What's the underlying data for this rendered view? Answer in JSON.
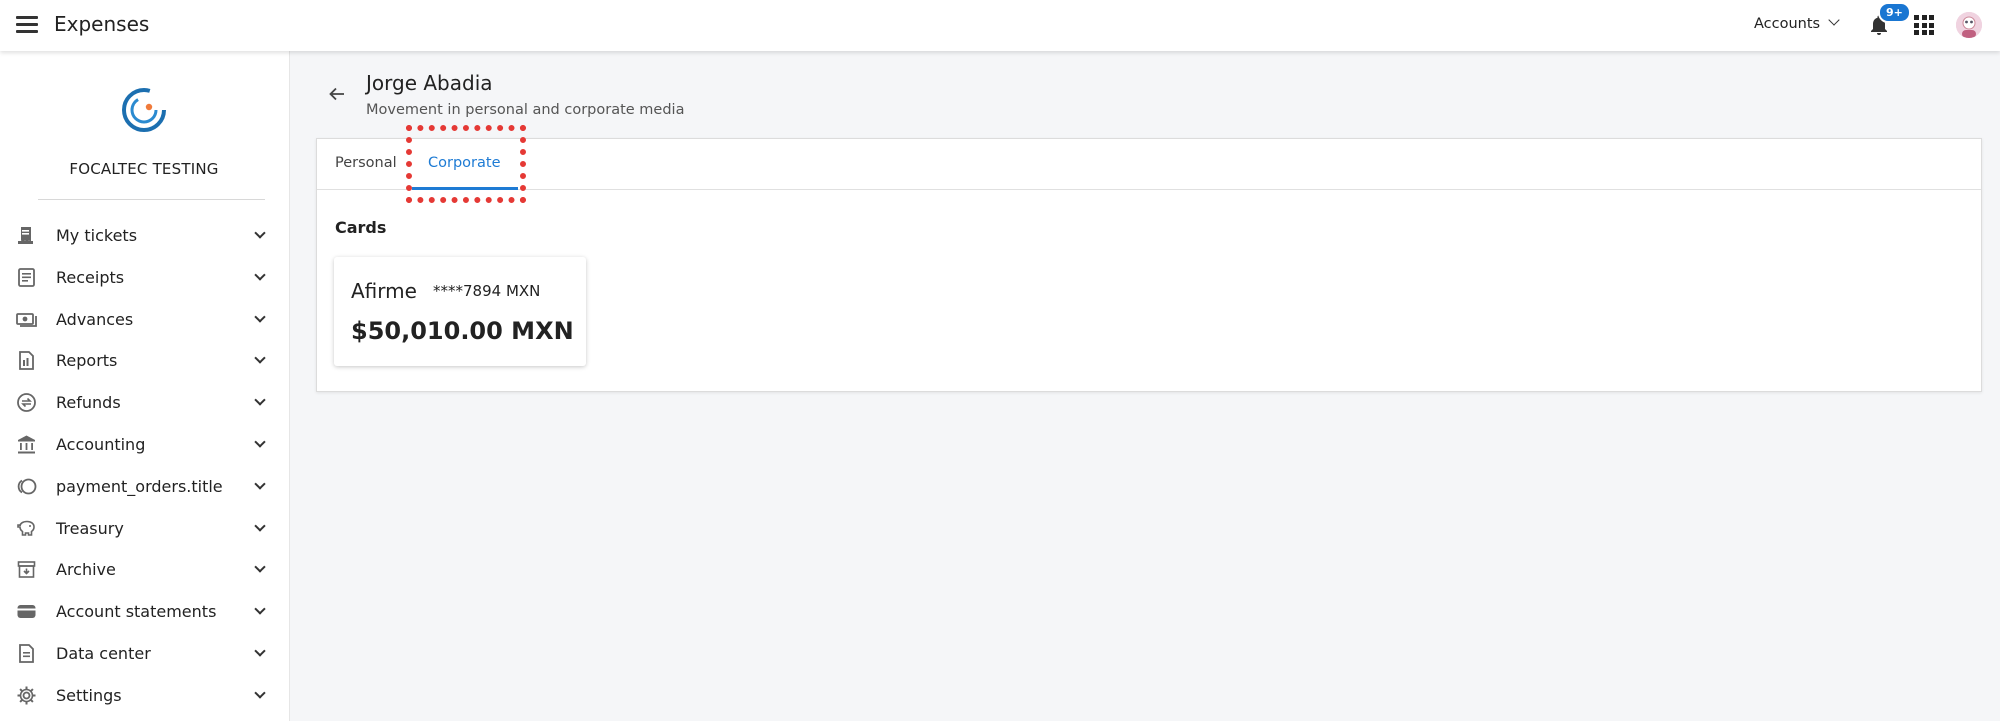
{
  "header": {
    "app_title": "Expenses",
    "accounts_label": "Accounts",
    "notifications_badge": "9+"
  },
  "sidebar": {
    "org_name": "FOCALTEC TESTING",
    "items": [
      {
        "label": "My tickets",
        "icon": "ticket-icon"
      },
      {
        "label": "Receipts",
        "icon": "receipt-icon"
      },
      {
        "label": "Advances",
        "icon": "cash-icon"
      },
      {
        "label": "Reports",
        "icon": "report-icon"
      },
      {
        "label": "Refunds",
        "icon": "refund-icon"
      },
      {
        "label": "Accounting",
        "icon": "bank-icon"
      },
      {
        "label": "payment_orders.title",
        "icon": "coins-icon"
      },
      {
        "label": "Treasury",
        "icon": "piggy-bank-icon"
      },
      {
        "label": "Archive",
        "icon": "archive-icon"
      },
      {
        "label": "Account statements",
        "icon": "wallet-icon"
      },
      {
        "label": "Data center",
        "icon": "data-file-icon"
      },
      {
        "label": "Settings",
        "icon": "gear-icon"
      }
    ]
  },
  "page": {
    "person_name": "Jorge Abadia",
    "subtitle": "Movement in personal and corporate media",
    "tabs": [
      {
        "label": "Personal",
        "active": false
      },
      {
        "label": "Corporate",
        "active": true
      }
    ],
    "cards_title": "Cards",
    "card": {
      "bank": "Afirme",
      "number": "****7894 MXN",
      "amount": "$50,010.00 MXN"
    }
  },
  "colors": {
    "accent": "#1e7bd4",
    "badge": "#1976d2",
    "highlight": "#e53935"
  }
}
